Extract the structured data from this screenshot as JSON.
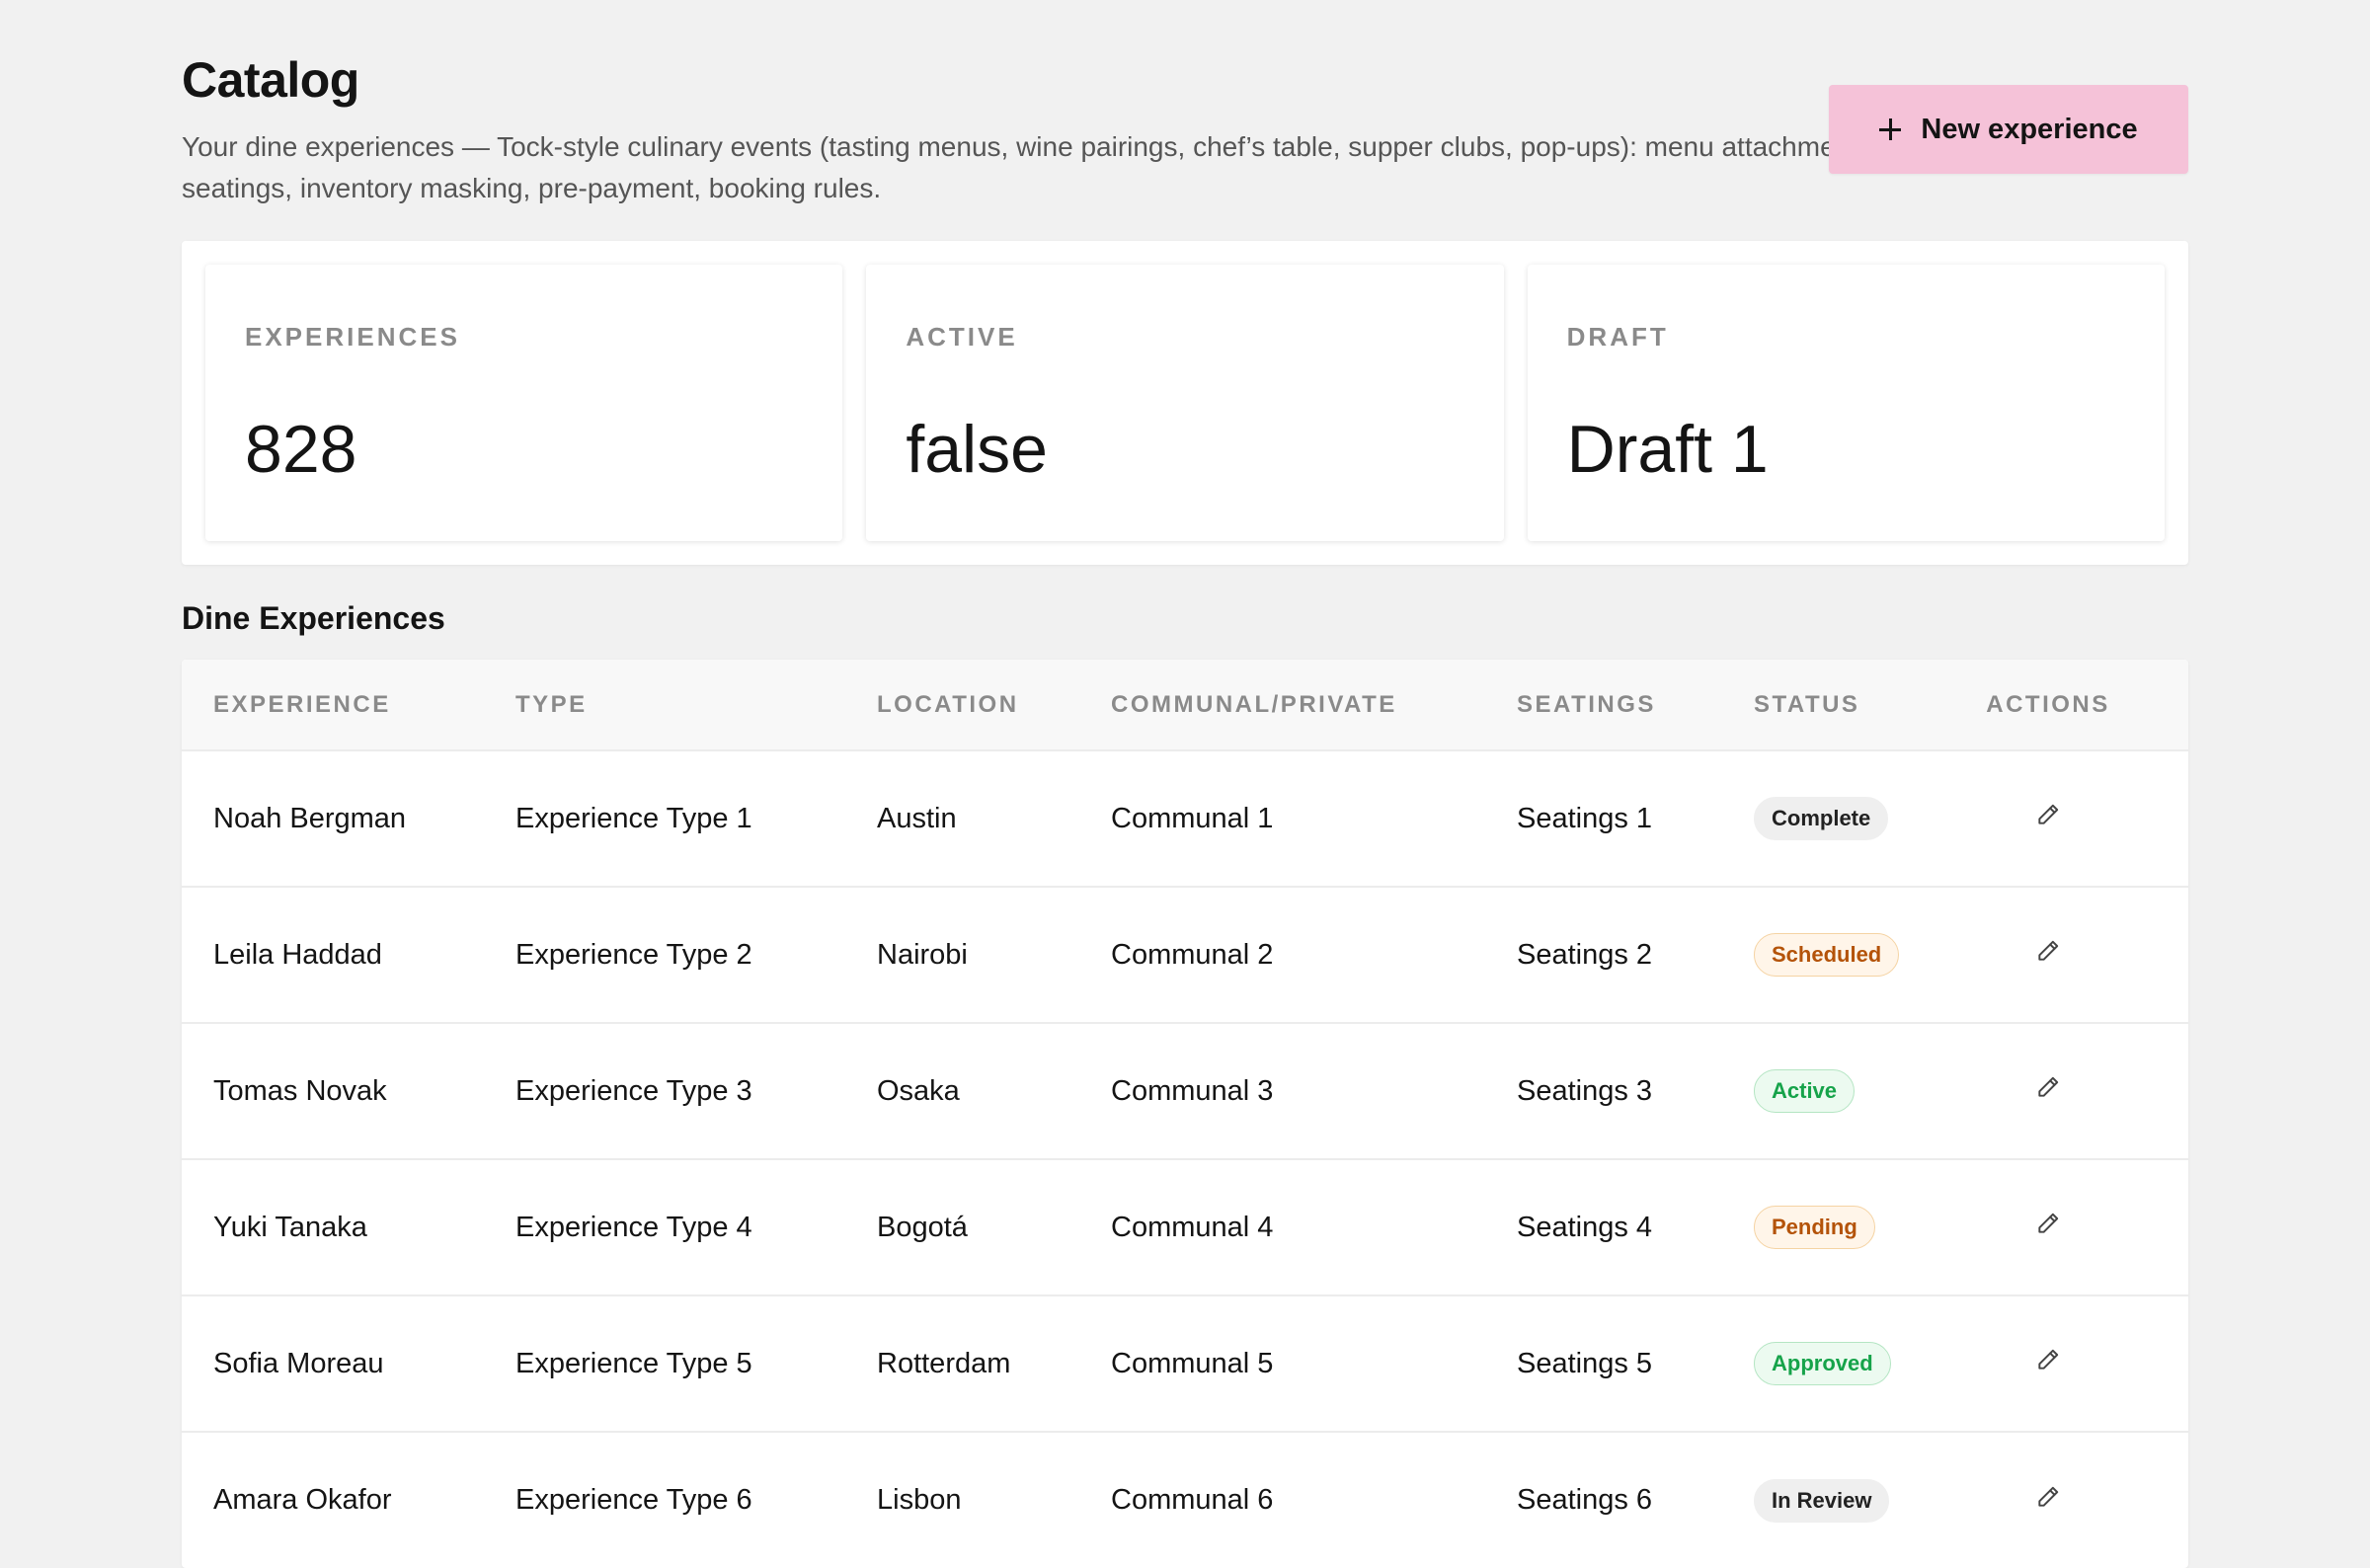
{
  "header": {
    "title": "Catalog",
    "subtitle": "Your dine experiences — Tock-style culinary events (tasting menus, wine pairings, chef’s table, supper clubs, pop-ups): menu attachment, seatings, inventory masking, pre-payment, booking rules.",
    "new_button_label": "New experience"
  },
  "stats": [
    {
      "label": "EXPERIENCES",
      "value": "828"
    },
    {
      "label": "ACTIVE",
      "value": "false"
    },
    {
      "label": "DRAFT",
      "value": "Draft 1"
    }
  ],
  "section_title": "Dine Experiences",
  "table": {
    "columns": [
      "EXPERIENCE",
      "TYPE",
      "LOCATION",
      "COMMUNAL/PRIVATE",
      "SEATINGS",
      "STATUS",
      "ACTIONS"
    ],
    "rows": [
      {
        "experience": "Noah Bergman",
        "type": "Experience Type 1",
        "location": "Austin",
        "communal": "Communal 1",
        "seatings": "Seatings 1",
        "status": "Complete",
        "status_tone": "neutral"
      },
      {
        "experience": "Leila Haddad",
        "type": "Experience Type 2",
        "location": "Nairobi",
        "communal": "Communal 2",
        "seatings": "Seatings 2",
        "status": "Scheduled",
        "status_tone": "orange"
      },
      {
        "experience": "Tomas Novak",
        "type": "Experience Type 3",
        "location": "Osaka",
        "communal": "Communal 3",
        "seatings": "Seatings 3",
        "status": "Active",
        "status_tone": "green"
      },
      {
        "experience": "Yuki Tanaka",
        "type": "Experience Type 4",
        "location": "Bogotá",
        "communal": "Communal 4",
        "seatings": "Seatings 4",
        "status": "Pending",
        "status_tone": "orange"
      },
      {
        "experience": "Sofia Moreau",
        "type": "Experience Type 5",
        "location": "Rotterdam",
        "communal": "Communal 5",
        "seatings": "Seatings 5",
        "status": "Approved",
        "status_tone": "green"
      },
      {
        "experience": "Amara Okafor",
        "type": "Experience Type 6",
        "location": "Lisbon",
        "communal": "Communal 6",
        "seatings": "Seatings 6",
        "status": "In Review",
        "status_tone": "neutral"
      }
    ]
  },
  "icons": {
    "add": "plus-icon",
    "edit": "pencil-icon"
  },
  "colors": {
    "accent": "#f5c2d8",
    "background": "#f1f1f1"
  }
}
